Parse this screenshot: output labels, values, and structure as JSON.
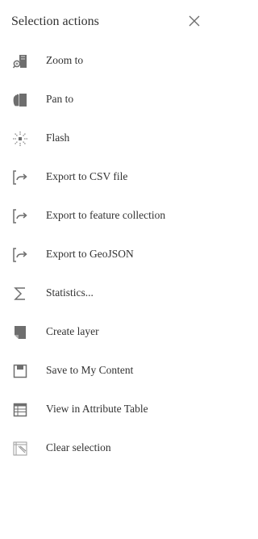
{
  "panel": {
    "title": "Selection actions",
    "close_icon": "close-icon",
    "icon_color": "#6e6e6e",
    "items": [
      {
        "label": "Zoom to",
        "icon": "zoom-to-icon"
      },
      {
        "label": "Pan to",
        "icon": "pan-to-icon"
      },
      {
        "label": "Flash",
        "icon": "flash-icon"
      },
      {
        "label": "Export to CSV file",
        "icon": "export-icon"
      },
      {
        "label": "Export to feature collection",
        "icon": "export-icon"
      },
      {
        "label": "Export to GeoJSON",
        "icon": "export-icon"
      },
      {
        "label": "Statistics...",
        "icon": "statistics-icon"
      },
      {
        "label": "Create layer",
        "icon": "create-layer-icon"
      },
      {
        "label": "Save to My Content",
        "icon": "save-icon"
      },
      {
        "label": "View in Attribute Table",
        "icon": "table-icon"
      },
      {
        "label": "Clear selection",
        "icon": "clear-selection-icon"
      }
    ]
  }
}
